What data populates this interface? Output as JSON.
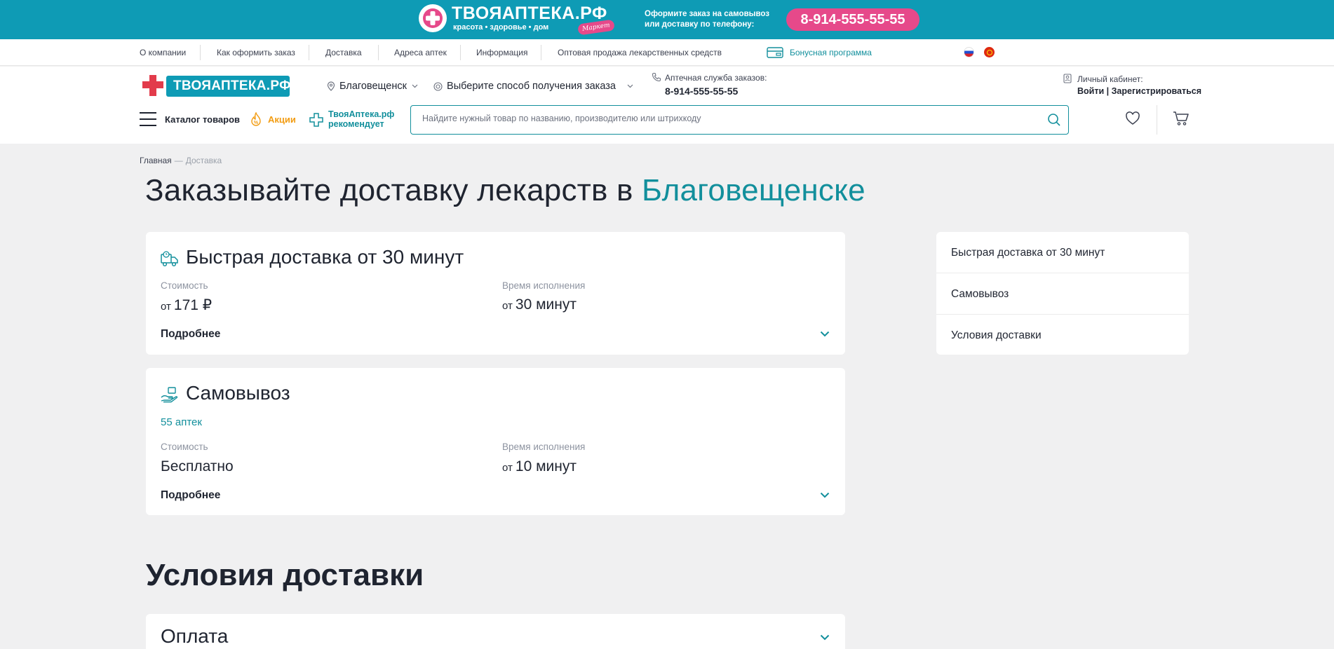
{
  "promo": {
    "brand": "ТВОЯАПТЕКА.РФ",
    "tagline": "красота • здоровье • дом",
    "stamp": "Маркет",
    "cta_line1": "Оформите заказ на самовывоз",
    "cta_line2": "или доставку по телефону:",
    "phone": "8-914-555-55-55"
  },
  "topnav": {
    "items": [
      "О компании",
      "Как оформить заказ",
      "Доставка",
      "Адреса аптек",
      "Информация",
      "Оптовая продажа лекарственных средств"
    ],
    "bonus": "Бонусная программа"
  },
  "header": {
    "logo_text": "ТВОЯАПТЕКА.РФ",
    "city": "Благовещенск",
    "delivery_select": "Выберите способ получения заказа",
    "phone_label": "Аптечная служба заказов:",
    "phone": "8-914-555-55-55",
    "account_label": "Личный кабинет:",
    "account_links": "Войти | Зарегистрироваться",
    "catalog": "Каталог товаров",
    "promos": "Акции",
    "recommends_line1": "ТвояАптека.рф",
    "recommends_line2": "рекомендует",
    "search_placeholder": "Найдите нужный товар по названию, производителю или штрихкоду"
  },
  "breadcrumb": {
    "home": "Главная",
    "sep": "—",
    "current": "Доставка"
  },
  "page": {
    "title_prefix": "Заказывайте доставку лекарств в",
    "title_city": "Благовещенске"
  },
  "cards": [
    {
      "title": "Быстрая доставка от 30 минут",
      "cost_label": "Стоимость",
      "cost_prefix": "от",
      "cost_value": "171 ₽",
      "time_label": "Время исполнения",
      "time_prefix": "от",
      "time_value": "30 минут",
      "more": "Подробнее"
    },
    {
      "title": "Самовывоз",
      "subtitle": "55 аптек",
      "cost_label": "Стоимость",
      "cost_value": "Бесплатно",
      "time_label": "Время исполнения",
      "time_prefix": "от",
      "time_value": "10 минут",
      "more": "Подробнее"
    }
  ],
  "side_nav": [
    "Быстрая доставка от 30 минут",
    "Самовывоз",
    "Условия доставки"
  ],
  "conditions": {
    "title": "Условия доставки",
    "payment_title": "Оплата"
  },
  "colors": {
    "brand_teal": "#0e9bb5",
    "accent_teal": "#128f9c",
    "brand_pink": "#e6498a",
    "promo_orange": "#f29c12"
  }
}
